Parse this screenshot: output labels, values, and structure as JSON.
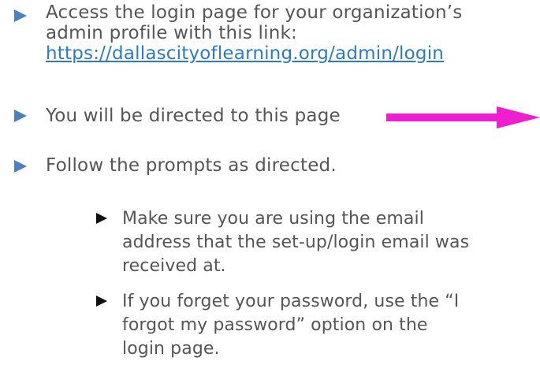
{
  "colors": {
    "text": "#555555",
    "bullet_level1": "#4a7fc1",
    "bullet_level2": "#111111",
    "link": "#2b7bc4",
    "arrow": "#ee1fcf"
  },
  "bullets": [
    {
      "lines": [
        "Access the login page for your organization’s",
        "admin profile with this link:"
      ],
      "link": "https://dallascityoflearning.org/admin/login"
    },
    {
      "text": "You will be directed to this page",
      "arrow_icon": "right-arrow-icon"
    },
    {
      "text": "Follow the prompts as directed."
    }
  ],
  "sub_bullets": [
    {
      "lines": [
        "Make sure you are using the email",
        "address that the set-up/login email was",
        "received at."
      ]
    },
    {
      "lines": [
        "If you forget your password, use the “I",
        "forgot my password” option on the",
        "login page."
      ]
    }
  ]
}
